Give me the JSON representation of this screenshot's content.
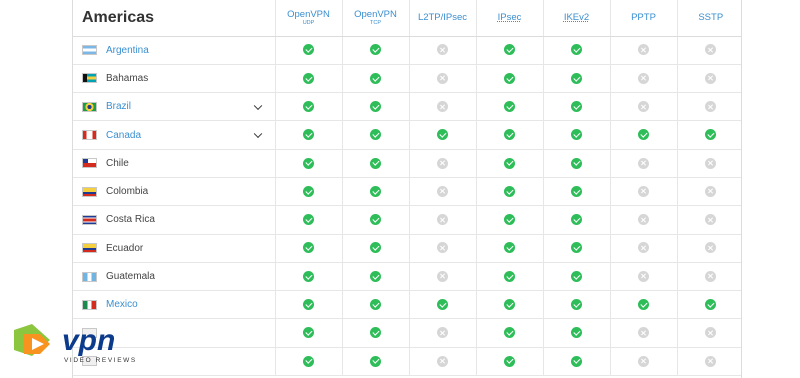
{
  "region": "Americas",
  "protocols": [
    {
      "name": "OpenVPN",
      "sub": "UDP",
      "dotted": false
    },
    {
      "name": "OpenVPN",
      "sub": "TCP",
      "dotted": false
    },
    {
      "name": "L2TP/IPsec",
      "sub": "",
      "dotted": false
    },
    {
      "name": "IPsec",
      "sub": "",
      "dotted": true
    },
    {
      "name": "IKEv2",
      "sub": "",
      "dotted": true
    },
    {
      "name": "PPTP",
      "sub": "",
      "dotted": false
    },
    {
      "name": "SSTP",
      "sub": "",
      "dotted": false
    }
  ],
  "rows": [
    {
      "country": "Argentina",
      "flag": "ar",
      "link": true,
      "expandable": false,
      "support": [
        true,
        true,
        false,
        true,
        true,
        false,
        false
      ]
    },
    {
      "country": "Bahamas",
      "flag": "bs",
      "link": false,
      "expandable": false,
      "support": [
        true,
        true,
        false,
        true,
        true,
        false,
        false
      ]
    },
    {
      "country": "Brazil",
      "flag": "br",
      "link": true,
      "expandable": true,
      "support": [
        true,
        true,
        false,
        true,
        true,
        false,
        false
      ]
    },
    {
      "country": "Canada",
      "flag": "ca",
      "link": true,
      "expandable": true,
      "support": [
        true,
        true,
        true,
        true,
        true,
        true,
        true
      ]
    },
    {
      "country": "Chile",
      "flag": "cl",
      "link": false,
      "expandable": false,
      "support": [
        true,
        true,
        false,
        true,
        true,
        false,
        false
      ]
    },
    {
      "country": "Colombia",
      "flag": "co",
      "link": false,
      "expandable": false,
      "support": [
        true,
        true,
        false,
        true,
        true,
        false,
        false
      ]
    },
    {
      "country": "Costa Rica",
      "flag": "cr",
      "link": false,
      "expandable": false,
      "support": [
        true,
        true,
        false,
        true,
        true,
        false,
        false
      ]
    },
    {
      "country": "Ecuador",
      "flag": "ec",
      "link": false,
      "expandable": false,
      "support": [
        true,
        true,
        false,
        true,
        true,
        false,
        false
      ]
    },
    {
      "country": "Guatemala",
      "flag": "gt",
      "link": false,
      "expandable": false,
      "support": [
        true,
        true,
        false,
        true,
        true,
        false,
        false
      ]
    },
    {
      "country": "Mexico",
      "flag": "mx",
      "link": true,
      "expandable": false,
      "support": [
        true,
        true,
        true,
        true,
        true,
        true,
        true
      ]
    },
    {
      "country": "",
      "flag": "blank",
      "link": false,
      "expandable": false,
      "support": [
        true,
        true,
        false,
        true,
        true,
        false,
        false
      ]
    },
    {
      "country": "",
      "flag": "blank",
      "link": false,
      "expandable": false,
      "support": [
        true,
        true,
        false,
        true,
        true,
        false,
        false
      ]
    }
  ],
  "watermark": {
    "brand": "vpn",
    "tagline": "VIDEO REVIEWS"
  },
  "colors": {
    "yes": "#2ebd59",
    "no": "#d6d6d6",
    "link": "#3a8fd0"
  }
}
